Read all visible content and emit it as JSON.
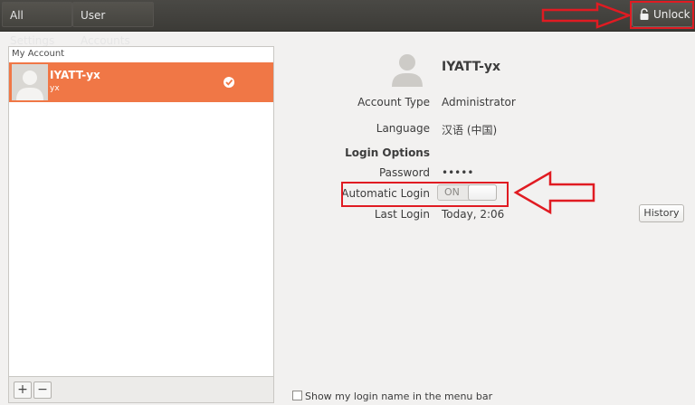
{
  "topbar": {
    "breadcrumbs": [
      "All Settings",
      "User Accounts"
    ],
    "unlock_label": "Unlock",
    "unlock_icon": "lock-icon"
  },
  "userlist": {
    "header": "My Account",
    "users": [
      {
        "fullname": "IYATT-yx",
        "login": "yx",
        "selected": true
      }
    ],
    "add_label": "+",
    "remove_label": "−"
  },
  "details": {
    "fullname": "IYATT-yx",
    "account_type_label": "Account Type",
    "account_type": "Administrator",
    "language_label": "Language",
    "language": "汉语 (中国)",
    "login_options_label": "Login Options",
    "password_label": "Password",
    "password_value": "•••••",
    "automatic_login_label": "Automatic Login",
    "automatic_login_state": "ON",
    "last_login_label": "Last Login",
    "last_login_value": "Today,  2:06",
    "history_label": "History"
  },
  "footer": {
    "show_login_name_label": "Show my login name in the menu bar"
  },
  "colors": {
    "accent": "#f07746",
    "topbar": "#3c3b37",
    "annotation": "#e01b22"
  }
}
